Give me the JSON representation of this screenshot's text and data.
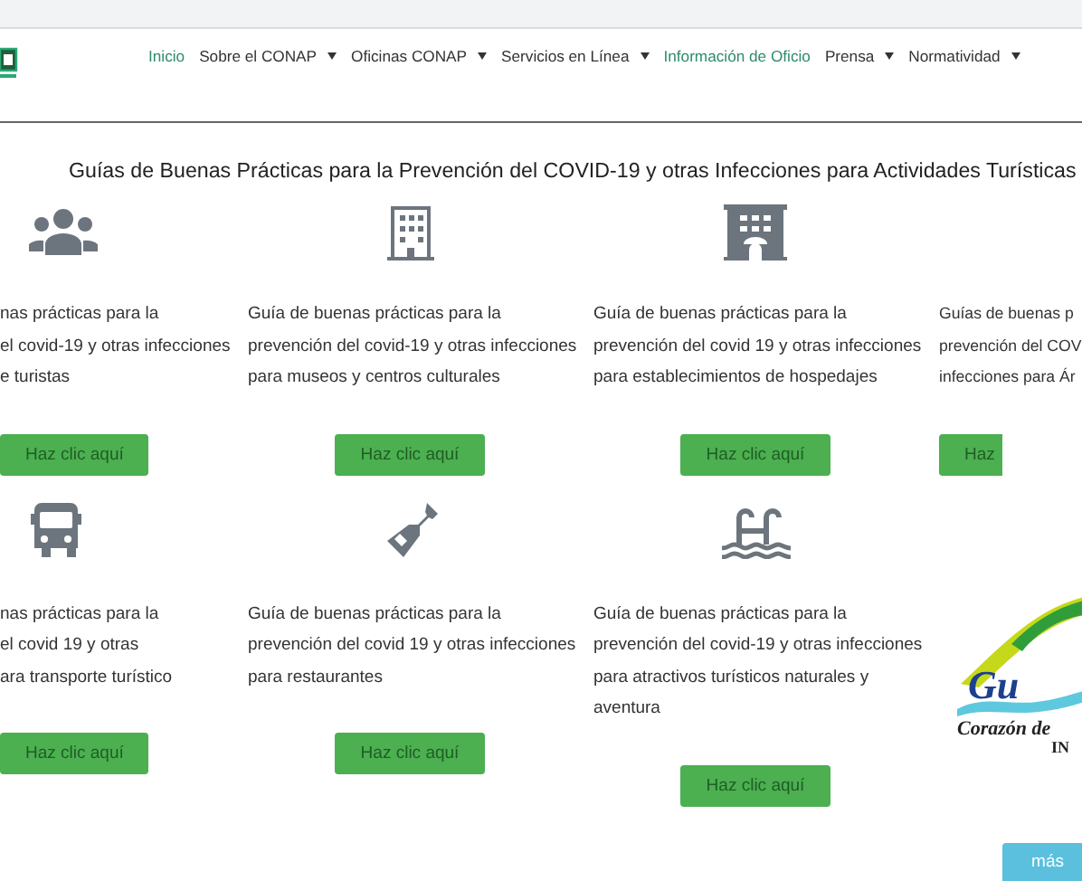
{
  "nav": {
    "items": [
      {
        "label": "Inicio",
        "highlighted": true,
        "dropdown": false
      },
      {
        "label": "Sobre el CONAP",
        "highlighted": false,
        "dropdown": true
      },
      {
        "label": "Oficinas CONAP",
        "highlighted": false,
        "dropdown": true
      },
      {
        "label": "Servicios en Línea",
        "highlighted": false,
        "dropdown": true
      },
      {
        "label": "Información de Oficio",
        "highlighted": true,
        "dropdown": false
      },
      {
        "label": "Prensa",
        "highlighted": false,
        "dropdown": true
      },
      {
        "label": "Normatividad",
        "highlighted": false,
        "dropdown": true
      }
    ]
  },
  "title": "Guías de Buenas Prácticas para la Prevención del COVID-19 y otras Infecciones para Actividades Turísticas",
  "cards": [
    {
      "kind": "people",
      "description": "nas prácticas para la\nel covid-19 y otras infecciones\ne turistas",
      "button": "Haz clic aquí"
    },
    {
      "kind": "building",
      "description": "Guía de buenas prácticas para la\nprevención del covid-19 y otras infecciones\npara museos y centros culturales",
      "button": "Haz clic aquí"
    },
    {
      "kind": "hotel",
      "description": "Guía de buenas prácticas para la\nprevención del covid 19 y otras infecciones\npara establecimientos de hospedajes",
      "button": "Haz clic aquí"
    },
    {
      "kind": "plain",
      "description": "Guías de buenas p\nprevención del COV\ninfecciones para Ár",
      "button": "Haz"
    },
    {
      "kind": "bus",
      "description": "nas prácticas para la\nel covid 19 y otras\nara transporte turístico",
      "button": "Haz clic aquí"
    },
    {
      "kind": "bottle",
      "description": "Guía de buenas prácticas para la\nprevención del covid 19 y otras infecciones\npara restaurantes",
      "button": "Haz clic aquí"
    },
    {
      "kind": "pool",
      "description": "Guía de buenas prácticas para la\nprevención del covid-19 y otras infecciones\npara atractivos turísticos naturales y\naventura",
      "button": "Haz clic aquí"
    }
  ],
  "logo": {
    "mark": "Gu",
    "slogan": "Corazón de",
    "sub": "IN"
  },
  "more_button": "más"
}
